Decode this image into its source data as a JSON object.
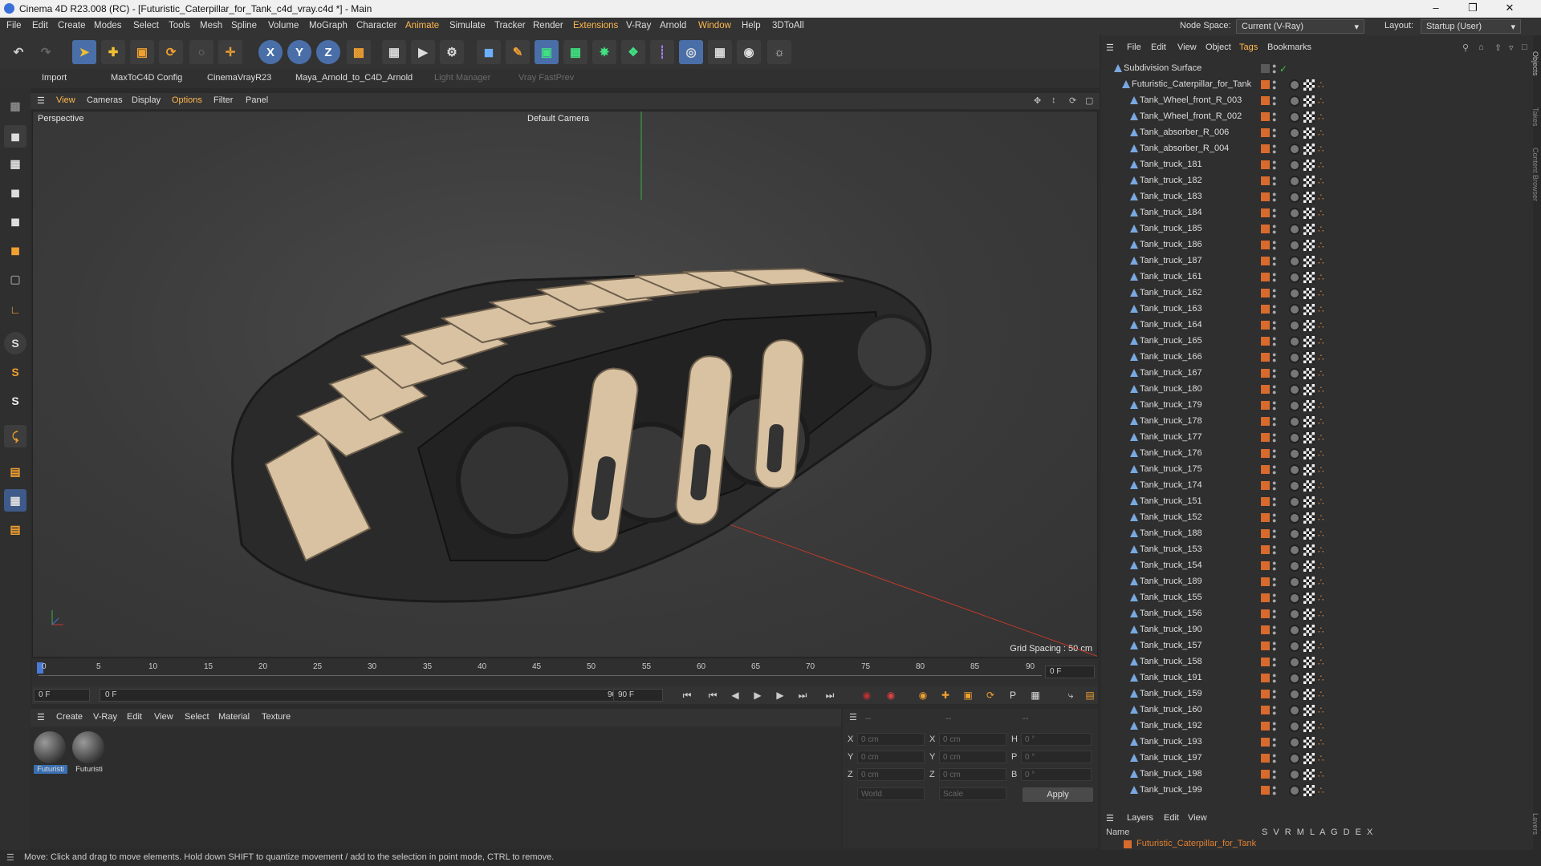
{
  "window": {
    "title": "Cinema 4D R23.008 (RC) - [Futuristic_Caterpillar_for_Tank_c4d_vray.c4d *] - Main"
  },
  "menu": [
    "File",
    "Edit",
    "Create",
    "Modes",
    "Select",
    "Tools",
    "Mesh",
    "Spline",
    "Volume",
    "MoGraph",
    "Character",
    "Animate",
    "Simulate",
    "Tracker",
    "Render",
    "Extensions",
    "V-Ray",
    "Arnold",
    "Window",
    "Help",
    "3DToAll"
  ],
  "node_space": {
    "label": "Node Space:",
    "value": "Current (V-Ray)"
  },
  "layout": {
    "label": "Layout:",
    "value": "Startup (User)"
  },
  "toolbar": {
    "x_label": "X",
    "y_label": "Y",
    "z_label": "Z"
  },
  "plugins": [
    "Import",
    "MaxToC4D Config",
    "CinemaVrayR23",
    "Maya_Arnold_to_C4D_Arnold",
    "Light Manager",
    "Vray FastPrev"
  ],
  "viewport_menu": [
    "View",
    "Cameras",
    "Display",
    "Options",
    "Filter",
    "Panel"
  ],
  "viewport": {
    "label": "Perspective",
    "camera": "Default Camera",
    "grid_spacing": "Grid Spacing : 50 cm"
  },
  "timeline": {
    "ticks": [
      "0",
      "5",
      "10",
      "15",
      "20",
      "25",
      "30",
      "35",
      "40",
      "45",
      "50",
      "55",
      "60",
      "65",
      "70",
      "75",
      "80",
      "85",
      "90"
    ],
    "frame_end_field": "0 F"
  },
  "transport": {
    "current": "0 F",
    "start": "0 F",
    "end": "90 F",
    "end2": "90 F"
  },
  "material_menu": [
    "Create",
    "V-Ray",
    "Edit",
    "View",
    "Select",
    "Material",
    "Texture"
  ],
  "materials": [
    "Futuristi",
    "Futuristi"
  ],
  "coords": {
    "col_labels": [
      "--",
      "--",
      "--"
    ],
    "rows": [
      {
        "a": "X",
        "av": "0 cm",
        "b": "X",
        "bv": "0 cm",
        "c": "H",
        "cv": "0 °"
      },
      {
        "a": "Y",
        "av": "0 cm",
        "b": "Y",
        "bv": "0 cm",
        "c": "P",
        "cv": "0 °"
      },
      {
        "a": "Z",
        "av": "0 cm",
        "b": "Z",
        "bv": "0 cm",
        "c": "B",
        "cv": "0 °"
      }
    ],
    "world": "World",
    "scale": "Scale",
    "apply": "Apply"
  },
  "objects_menu": [
    "File",
    "Edit",
    "View",
    "Object",
    "Tags",
    "Bookmarks"
  ],
  "objects": {
    "root": "Subdivision Surface",
    "group": "Futuristic_Caterpillar_for_Tank",
    "items": [
      "Tank_Wheel_front_R_003",
      "Tank_Wheel_front_R_002",
      "Tank_absorber_R_006",
      "Tank_absorber_R_004",
      "Tank_truck_181",
      "Tank_truck_182",
      "Tank_truck_183",
      "Tank_truck_184",
      "Tank_truck_185",
      "Tank_truck_186",
      "Tank_truck_187",
      "Tank_truck_161",
      "Tank_truck_162",
      "Tank_truck_163",
      "Tank_truck_164",
      "Tank_truck_165",
      "Tank_truck_166",
      "Tank_truck_167",
      "Tank_truck_180",
      "Tank_truck_179",
      "Tank_truck_178",
      "Tank_truck_177",
      "Tank_truck_176",
      "Tank_truck_175",
      "Tank_truck_174",
      "Tank_truck_151",
      "Tank_truck_152",
      "Tank_truck_188",
      "Tank_truck_153",
      "Tank_truck_154",
      "Tank_truck_189",
      "Tank_truck_155",
      "Tank_truck_156",
      "Tank_truck_190",
      "Tank_truck_157",
      "Tank_truck_158",
      "Tank_truck_191",
      "Tank_truck_159",
      "Tank_truck_160",
      "Tank_truck_192",
      "Tank_truck_193",
      "Tank_truck_197",
      "Tank_truck_198",
      "Tank_truck_199"
    ]
  },
  "layers_menu": [
    "Layers",
    "Edit",
    "View"
  ],
  "layers": {
    "columns": "S V R M L A G D E X",
    "name_header": "Name",
    "row": "Futuristic_Caterpillar_for_Tank"
  },
  "right_tabs": [
    "Objects",
    "Takes",
    "Content Browser",
    "Layers"
  ],
  "status": "Move: Click and drag to move elements. Hold down SHIFT to quantize movement / add to the selection in point mode, CTRL to remove."
}
